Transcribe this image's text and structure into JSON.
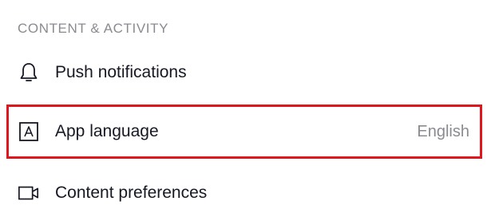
{
  "section": {
    "title": "CONTENT & ACTIVITY"
  },
  "rows": [
    {
      "label": "Push notifications",
      "icon": "bell-icon"
    },
    {
      "label": "App language",
      "value": "English",
      "icon": "language-icon",
      "highlighted": true
    },
    {
      "label": "Content preferences",
      "icon": "video-camera-icon"
    }
  ],
  "colors": {
    "highlight_border": "#e0161f",
    "secondary_text": "#8a8b91",
    "primary_text": "#161823"
  }
}
